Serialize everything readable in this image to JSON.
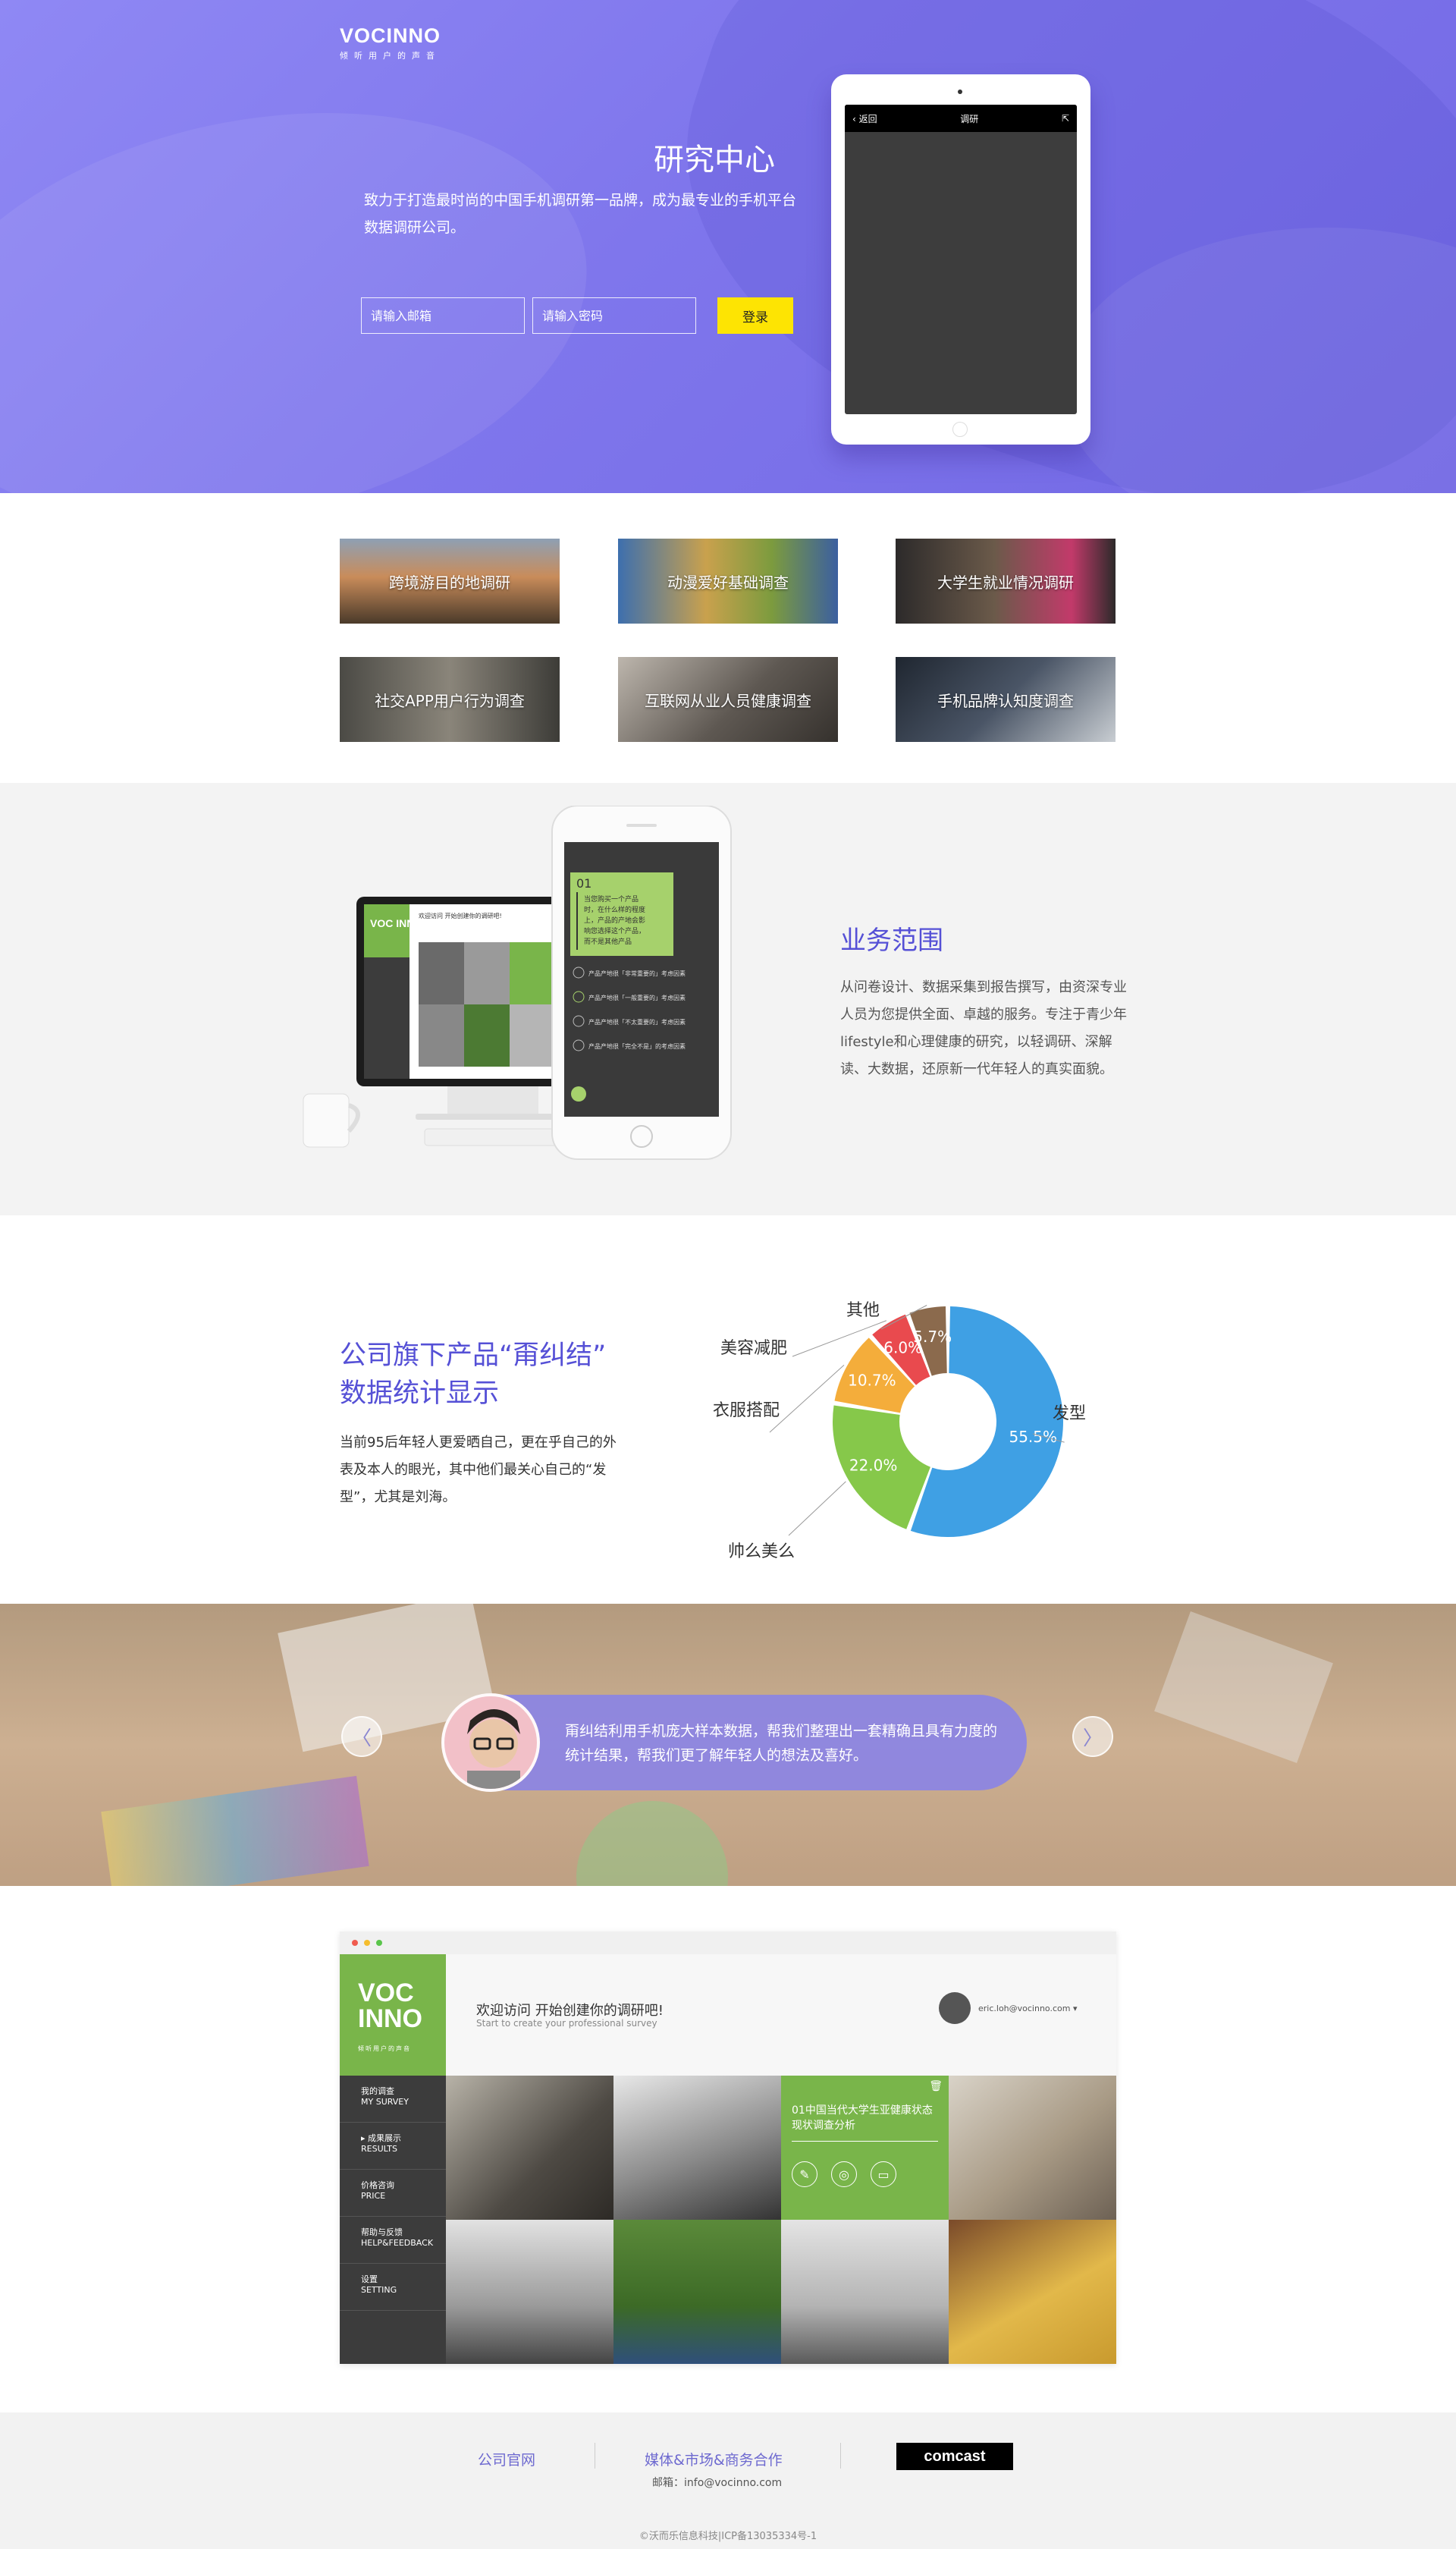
{
  "hero": {
    "logo": "VOCINNO",
    "logo_sub": "倾听用户的声音",
    "title": "研究中心",
    "description": "致力于打造最时尚的中国手机调研第一品牌，成为最专业的手机平台数据调研公司。",
    "email_placeholder": "请输入邮箱",
    "password_placeholder": "请输入密码",
    "login_label": "登录",
    "tablet": {
      "back": "返回",
      "title": "调研"
    }
  },
  "surveys": [
    {
      "label": "跨境游目的地调研",
      "bg": "#6d6250"
    },
    {
      "label": "动漫爱好基础调查",
      "bg": "#5b7fa8"
    },
    {
      "label": "大学生就业情况调研",
      "bg": "#3f3a36"
    },
    {
      "label": "社交APP用户行为调查",
      "bg": "#52524e"
    },
    {
      "label": "互联网从业人员健康调查",
      "bg": "#6f6a63"
    },
    {
      "label": "手机品牌认知度调查",
      "bg": "#2f3540"
    }
  ],
  "business": {
    "title": "业务范围",
    "description": "从问卷设计、数据采集到报告撰写，由资深专业人员为您提供全面、卓越的服务。专注于青少年lifestyle和心理健康的研究，以轻调研、深解读、大数据，还原新一代年轻人的真实面貌。",
    "monitor": {
      "logo": "VOC INNO",
      "welcome": "欢迎访问 开始创建你的调研吧!"
    },
    "phone": {
      "num": "01",
      "question": "当您购买一个产品时，在什么样的程度上，产品的产地会影响您选择这个产品，而不是其他产品",
      "options": [
        "产品产地很「非常重要的」考虑因素",
        "产品产地很「一般重要的」考虑因素",
        "产品产地很「不太重要的」考虑因素",
        "产品产地很「完全不是」的考虑因素"
      ]
    }
  },
  "stats": {
    "title_line1": "公司旗下产品“甭纠结”",
    "title_line2": "数据统计显示",
    "description": "当前95后年轻人更爱晒自己，更在乎自己的外表及本人的眼光，其中他们最关心自己的“发型”，尤其是刘海。"
  },
  "chart_data": {
    "type": "pie",
    "title": "",
    "series": [
      {
        "name": "发型",
        "value": 55.5,
        "label": "55.5%",
        "color": "#3fa0e4"
      },
      {
        "name": "帅么美么",
        "value": 22.0,
        "label": "22.0%",
        "color": "#86c84a"
      },
      {
        "name": "衣服搭配",
        "value": 10.7,
        "label": "10.7%",
        "color": "#f4ad3b"
      },
      {
        "name": "美容减肥",
        "value": 6.0,
        "label": "6.0%",
        "color": "#e94a4e"
      },
      {
        "name": "其他",
        "value": 5.7,
        "label": "5.7%",
        "color": "#8b6a4d"
      }
    ],
    "donut": true,
    "legend": "callouts"
  },
  "testimonial": {
    "quote": "甭纠结利用手机庞大样本数据，帮我们整理出一套精确且具有力度的统计结果，帮我们更了解年轻人的想法及喜好。",
    "prev": "〈",
    "next": "〉"
  },
  "dashboard": {
    "logo": "VOC INNO",
    "logo_sub": "倾听用户的声音",
    "welcome": "欢迎访问 开始创建你的调研吧!",
    "welcome_en": "Start to create your professional survey",
    "user": "eric.loh@vocinno.com ▾",
    "menu": [
      {
        "cn": "我的调查",
        "en": "MY SURVEY"
      },
      {
        "cn": "成果展示",
        "en": "RESULTS"
      },
      {
        "cn": "价格咨询",
        "en": "PRICE"
      },
      {
        "cn": "帮助与反馈",
        "en": "HELP&FEEDBACK"
      },
      {
        "cn": "设置",
        "en": "SETTING"
      }
    ],
    "featured": "01中国当代大学生亚健康状态现状调查分析"
  },
  "footer": {
    "link1": "公司官网",
    "link2": "媒体&市场&商务合作",
    "email": "邮箱：info@vocinno.com",
    "partner": "comcast",
    "copyright": "©沃而乐信息科技|ICP备13035334号-1"
  }
}
